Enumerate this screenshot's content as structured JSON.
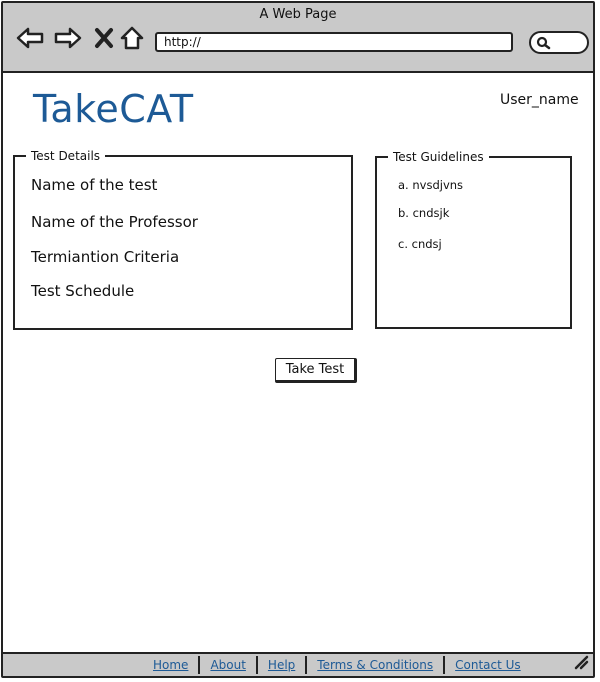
{
  "browser": {
    "window_title": "A Web Page",
    "url": "http://",
    "icons": [
      "back-arrow-icon",
      "forward-arrow-icon",
      "close-x-icon",
      "home-icon",
      "search-icon"
    ]
  },
  "header": {
    "logo": "TakeCAT",
    "username": "User_name"
  },
  "test_details": {
    "legend": "Test Details",
    "items": [
      "Name of the test",
      "Name of the Professor",
      "Termiantion Criteria",
      "Test Schedule"
    ]
  },
  "test_guidelines": {
    "legend": "Test Guidelines",
    "items": [
      "a. nvsdjvns",
      "b. cndsjk",
      "c. cndsj"
    ]
  },
  "actions": {
    "take_test_label": "Take Test"
  },
  "footer": {
    "links": [
      "Home",
      "About",
      "Help",
      "Terms & Conditions",
      "Contact Us"
    ]
  },
  "colors": {
    "logo": "#1d5a96",
    "link": "#1d5a96",
    "chrome": "#c9c9c9"
  }
}
